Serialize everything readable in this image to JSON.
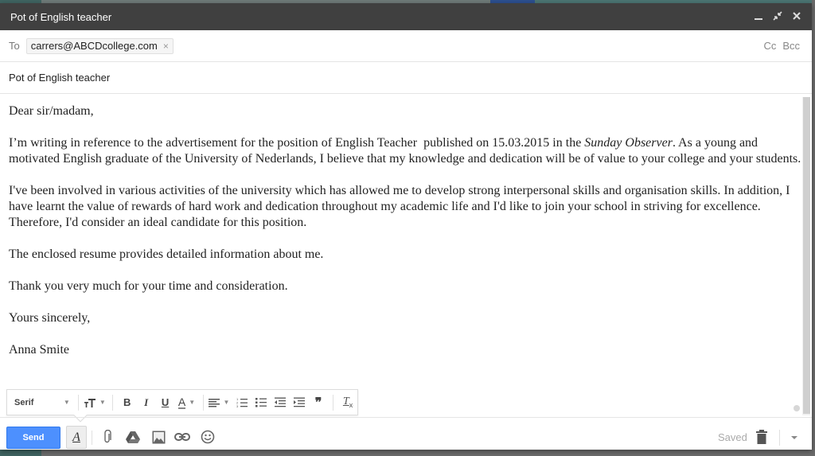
{
  "window": {
    "title": "Pot of English teacher",
    "controls": [
      {
        "name": "minimize-icon",
        "label": "Minimize"
      },
      {
        "name": "exit-fullscreen-icon",
        "label": "Exit full screen"
      },
      {
        "name": "close-icon",
        "label": "Close"
      }
    ]
  },
  "recipients": {
    "to_label": "To",
    "to_chips": [
      {
        "email": "carrers@ABCDcollege.com",
        "remove_glyph": "×"
      }
    ],
    "cc_label": "Cc",
    "bcc_label": "Bcc"
  },
  "subject": {
    "value": "Pot of English teacher"
  },
  "body": {
    "greeting": "Dear sir/madam,",
    "p1_before": "I’m writing in reference to the advertisement for the position of English Teacher  published on 15.03.2015 in the ",
    "p1_italic": "Sunday Observer",
    "p1_after": ". As a young and motivated English graduate of the University of Nederlands, I believe that my knowledge and dedication will be of value to your college and your students.",
    "p2": "I've been involved in various activities of the university which has allowed me to develop strong interpersonal skills and organisation skills. In addition, I have learnt the value of rewards of hard work and dedication throughout my academic life and I'd like to join your school in striving for excellence. Therefore, I'd consider an ideal candidate for this position.",
    "p3": "The enclosed resume provides detailed information about me.",
    "p4": "Thank you very much for your time and consideration.",
    "closing": "Yours sincerely,",
    "signature": "Anna Smite"
  },
  "formatting_toolbar": {
    "font_family": "Serif",
    "size_glyph": "тT",
    "bold_glyph": "B",
    "italic_glyph": "I",
    "underline_glyph": "U",
    "text_color_glyph": "A",
    "quote_glyph": "❞",
    "clear_glyph": "T"
  },
  "bottom_bar": {
    "send_label": "Send",
    "format_toggle_glyph": "A",
    "saved_status": "Saved"
  },
  "colors": {
    "titlebar": "#404040",
    "send_button": "#4d90fe",
    "text": "#222222"
  }
}
